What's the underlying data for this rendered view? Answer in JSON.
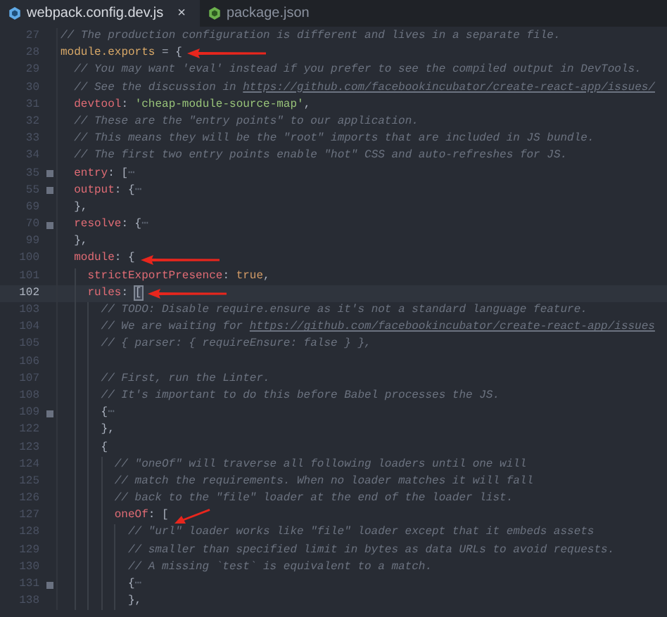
{
  "tabs": [
    {
      "label": "webpack.config.dev.js",
      "selected": true,
      "close": "×"
    },
    {
      "label": "package.json",
      "selected": false
    }
  ],
  "lines": [
    {
      "number": "27",
      "kind": "plain",
      "tokens": [
        {
          "kind": "comment",
          "text": "// The production configuration is different and lives in a separate file."
        }
      ]
    },
    {
      "number": "28",
      "kind": "arrowed",
      "tokens": [
        {
          "kind": "var",
          "text": "module.exports"
        },
        {
          "kind": "punct",
          "text": " = {"
        }
      ],
      "children": [
        {
          "number": "29",
          "kind": "plain",
          "tokens": [
            {
              "kind": "comment",
              "text": "// You may want 'eval' instead if you prefer to see the compiled output in DevTools."
            }
          ]
        },
        {
          "number": "30",
          "kind": "plain",
          "tokens": [
            {
              "kind": "comment",
              "text": "// See the discussion in "
            },
            {
              "kind": "link",
              "text": "https://github.com/facebookincubator/create-react-app/issues/"
            }
          ]
        },
        {
          "number": "31",
          "kind": "plain",
          "tokens": [
            {
              "kind": "key",
              "text": "devtool"
            },
            {
              "kind": "punct",
              "text": ": "
            },
            {
              "kind": "string",
              "text": "'cheap-module-source-map'"
            },
            {
              "kind": "punct",
              "text": ","
            }
          ]
        },
        {
          "number": "32",
          "kind": "plain",
          "tokens": [
            {
              "kind": "comment",
              "text": "// These are the \"entry points\" to our application."
            }
          ]
        },
        {
          "number": "33",
          "kind": "plain",
          "tokens": [
            {
              "kind": "comment",
              "text": "// This means they will be the \"root\" imports that are included in JS bundle."
            }
          ]
        },
        {
          "number": "34",
          "kind": "plain",
          "tokens": [
            {
              "kind": "comment",
              "text": "// The first two entry points enable \"hot\" CSS and auto-refreshes for JS."
            }
          ]
        },
        {
          "number": "35",
          "kind": "plain",
          "collapsed": true,
          "tokens": [
            {
              "kind": "key",
              "text": "entry"
            },
            {
              "kind": "punct",
              "text": ": ["
            },
            {
              "kind": "fold",
              "text": "⋯"
            }
          ]
        },
        {
          "number": "55",
          "kind": "plain",
          "collapsed": true,
          "tokens": [
            {
              "kind": "key",
              "text": "output"
            },
            {
              "kind": "punct",
              "text": ": {"
            },
            {
              "kind": "fold",
              "text": "⋯"
            }
          ]
        },
        {
          "number": "69",
          "kind": "plain",
          "tokens": [
            {
              "kind": "punct",
              "text": "},"
            }
          ]
        },
        {
          "number": "70",
          "kind": "plain",
          "collapsed": true,
          "tokens": [
            {
              "kind": "key",
              "text": "resolve"
            },
            {
              "kind": "punct",
              "text": ": {"
            },
            {
              "kind": "fold",
              "text": "⋯"
            }
          ]
        },
        {
          "number": "99",
          "kind": "plain",
          "tokens": [
            {
              "kind": "punct",
              "text": "},"
            }
          ]
        },
        {
          "number": "100",
          "kind": "arrowed",
          "tokens": [
            {
              "kind": "key",
              "text": "module"
            },
            {
              "kind": "punct",
              "text": ": {"
            }
          ],
          "children": [
            {
              "number": "101",
              "kind": "plain",
              "tokens": [
                {
                  "kind": "key",
                  "text": "strictExportPresence"
                },
                {
                  "kind": "punct",
                  "text": ": "
                },
                {
                  "kind": "bool",
                  "text": "true"
                },
                {
                  "kind": "punct",
                  "text": ","
                }
              ]
            },
            {
              "number": "102",
              "kind": "arrowed",
              "current": true,
              "tokens": [
                {
                  "kind": "key",
                  "text": "rules"
                },
                {
                  "kind": "punct",
                  "text": ": "
                },
                {
                  "kind": "cursor",
                  "text": "["
                }
              ],
              "children": [
                {
                  "number": "103",
                  "kind": "plain",
                  "tokens": [
                    {
                      "kind": "comment",
                      "text": "// TODO: Disable require.ensure as it's not a standard language feature."
                    }
                  ]
                },
                {
                  "number": "104",
                  "kind": "plain",
                  "tokens": [
                    {
                      "kind": "comment",
                      "text": "// We are waiting for "
                    },
                    {
                      "kind": "link",
                      "text": "https://github.com/facebookincubator/create-react-app/issues"
                    }
                  ]
                },
                {
                  "number": "105",
                  "kind": "plain",
                  "tokens": [
                    {
                      "kind": "comment",
                      "text": "// { parser: { requireEnsure: false } },"
                    }
                  ]
                },
                {
                  "number": "106",
                  "kind": "plain"
                },
                {
                  "number": "107",
                  "kind": "plain",
                  "tokens": [
                    {
                      "kind": "comment",
                      "text": "// First, run the Linter."
                    }
                  ]
                },
                {
                  "number": "108",
                  "kind": "plain",
                  "tokens": [
                    {
                      "kind": "comment",
                      "text": "// It's important to do this before Babel processes the JS."
                    }
                  ]
                },
                {
                  "number": "109",
                  "kind": "plain",
                  "collapsed": true,
                  "tokens": [
                    {
                      "kind": "punct",
                      "text": "{"
                    },
                    {
                      "kind": "fold",
                      "text": "⋯"
                    }
                  ]
                },
                {
                  "number": "122",
                  "kind": "plain",
                  "tokens": [
                    {
                      "kind": "punct",
                      "text": "},"
                    }
                  ]
                },
                {
                  "number": "123",
                  "kind": "plain",
                  "tokens": [
                    {
                      "kind": "punct",
                      "text": "{"
                    }
                  ],
                  "children": [
                    {
                      "number": "124",
                      "kind": "plain",
                      "tokens": [
                        {
                          "kind": "comment",
                          "text": "// \"oneOf\" will traverse all following loaders until one will"
                        }
                      ]
                    },
                    {
                      "number": "125",
                      "kind": "plain",
                      "tokens": [
                        {
                          "kind": "comment",
                          "text": "// match the requirements. When no loader matches it will fall"
                        }
                      ]
                    },
                    {
                      "number": "126",
                      "kind": "plain",
                      "tokens": [
                        {
                          "kind": "comment",
                          "text": "// back to the \"file\" loader at the end of the loader list."
                        }
                      ]
                    },
                    {
                      "number": "127",
                      "kind": "slanted",
                      "tokens": [
                        {
                          "kind": "key",
                          "text": "oneOf"
                        },
                        {
                          "kind": "punct",
                          "text": ": ["
                        }
                      ],
                      "children": [
                        {
                          "number": "128",
                          "kind": "plain",
                          "tokens": [
                            {
                              "kind": "comment",
                              "text": "// \"url\" loader works like \"file\" loader except that it embeds assets"
                            }
                          ]
                        },
                        {
                          "number": "129",
                          "kind": "plain",
                          "tokens": [
                            {
                              "kind": "comment",
                              "text": "// smaller than specified limit in bytes as data URLs to avoid requests."
                            }
                          ]
                        },
                        {
                          "number": "130",
                          "kind": "plain",
                          "tokens": [
                            {
                              "kind": "comment",
                              "text": "// A missing `test` is equivalent to a match."
                            }
                          ]
                        },
                        {
                          "number": "131",
                          "kind": "plain",
                          "collapsed": true,
                          "tokens": [
                            {
                              "kind": "punct",
                              "text": "{"
                            },
                            {
                              "kind": "fold",
                              "text": "⋯"
                            }
                          ]
                        },
                        {
                          "number": "138",
                          "kind": "plain",
                          "tokens": [
                            {
                              "kind": "punct",
                              "text": "},"
                            }
                          ]
                        }
                      ]
                    }
                  ]
                }
              ]
            }
          ]
        }
      ]
    }
  ]
}
